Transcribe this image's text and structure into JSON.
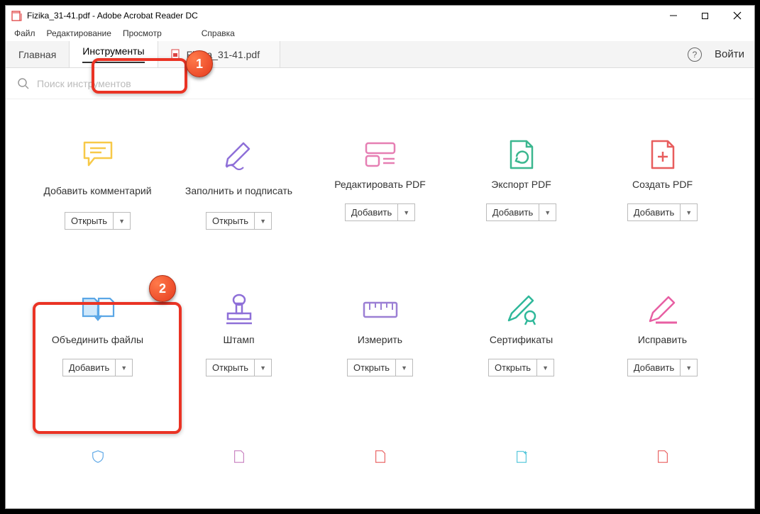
{
  "window": {
    "title": "Fizika_31-41.pdf - Adobe Acrobat Reader DC"
  },
  "menubar": {
    "file": "Файл",
    "edit": "Редактирование",
    "view": "Просмотр",
    "window_help": "Справка"
  },
  "tabs": {
    "home": "Главная",
    "tools": "Инструменты",
    "document": "Fizika_31-41.pdf"
  },
  "right_controls": {
    "login": "Войти"
  },
  "search": {
    "placeholder": "Поиск инструментов"
  },
  "buttons": {
    "open": "Открыть",
    "add": "Добавить"
  },
  "tools": {
    "comment": {
      "label": "Добавить комментарий"
    },
    "fill_sign": {
      "label": "Заполнить и подписать"
    },
    "edit_pdf": {
      "label": "Редактировать PDF"
    },
    "export_pdf": {
      "label": "Экспорт PDF"
    },
    "create_pdf": {
      "label": "Создать PDF"
    },
    "combine": {
      "label": "Объединить файлы"
    },
    "stamp": {
      "label": "Штамп"
    },
    "measure": {
      "label": "Измерить"
    },
    "certificates": {
      "label": "Сертификаты"
    },
    "redact": {
      "label": "Исправить"
    }
  },
  "annotations": {
    "badge1": "1",
    "badge2": "2"
  }
}
